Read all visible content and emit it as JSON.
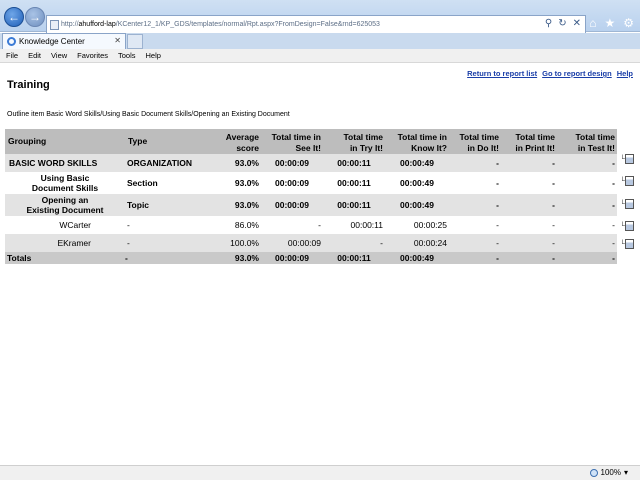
{
  "browser": {
    "url_prefix": "http://",
    "url_host": "ahufford-lap",
    "url_path": "/KCenter12_1/KP_GDS/templates/normal/Rpt.aspx?FromDesign=False&rnd=625053",
    "tab_title": "Knowledge Center",
    "menu": [
      "File",
      "Edit",
      "View",
      "Favorites",
      "Tools",
      "Help"
    ],
    "zoom": "100%"
  },
  "page": {
    "title": "Training",
    "links": {
      "return": "Return to report list",
      "design": "Go to report design",
      "help": "Help"
    },
    "outline": "Outline item Basic Word Skills/Using Basic Document Skills/Opening an Existing Document"
  },
  "table": {
    "headers": {
      "grouping": "Grouping",
      "type": "Type",
      "avg1": "Average",
      "avg2": "score",
      "see1": "Total time in",
      "see2": "See It!",
      "try1": "Total time",
      "try2": "in Try It!",
      "know1": "Total time in",
      "know2": "Know It?",
      "do1": "Total time",
      "do2": "in Do It!",
      "print1": "Total time",
      "print2": "in Print It!",
      "test1": "Total time",
      "test2": "in Test It!"
    },
    "rows": [
      {
        "grouping": "BASIC WORD SKILLS",
        "type": "ORGANIZATION",
        "avg": "93.0%",
        "see": "00:00:09",
        "try": "00:00:11",
        "know": "00:00:49",
        "do": "-",
        "print": "-",
        "test": "-"
      },
      {
        "grouping1": "Using Basic",
        "grouping2": "Document Skills",
        "type": "Section",
        "avg": "93.0%",
        "see": "00:00:09",
        "try": "00:00:11",
        "know": "00:00:49",
        "do": "-",
        "print": "-",
        "test": "-"
      },
      {
        "grouping1": "Opening an",
        "grouping2": "Existing Document",
        "type": "Topic",
        "avg": "93.0%",
        "see": "00:00:09",
        "try": "00:00:11",
        "know": "00:00:49",
        "do": "-",
        "print": "-",
        "test": "-"
      },
      {
        "grouping": "WCarter",
        "type": "-",
        "avg": "86.0%",
        "see": "-",
        "try": "00:00:11",
        "know": "00:00:25",
        "do": "-",
        "print": "-",
        "test": "-"
      },
      {
        "grouping": "EKramer",
        "type": "-",
        "avg": "100.0%",
        "see": "00:00:09",
        "try": "-",
        "know": "00:00:24",
        "do": "-",
        "print": "-",
        "test": "-"
      }
    ],
    "totals": {
      "label": "Totals",
      "type": "-",
      "avg": "93.0%",
      "see": "00:00:09",
      "try": "00:00:11",
      "know": "00:00:49",
      "do": "-",
      "print": "-",
      "test": "-"
    }
  }
}
